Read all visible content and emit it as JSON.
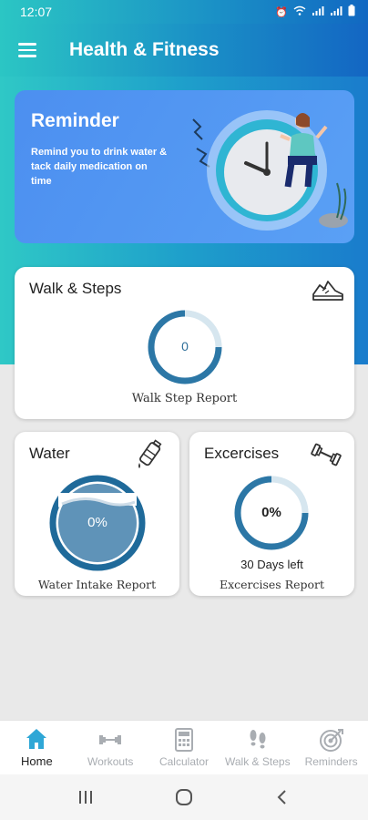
{
  "status_bar": {
    "time": "12:07"
  },
  "app_bar": {
    "title": "Health & Fitness"
  },
  "reminder": {
    "title": "Reminder",
    "text": "Remind you to drink water & tack daily medication on time"
  },
  "walk": {
    "title": "Walk & Steps",
    "steps": "0",
    "progress": 0,
    "footer": "Walk Step Report"
  },
  "water": {
    "title": "Water",
    "percent": "0%",
    "footer": "Water Intake Report"
  },
  "exercises": {
    "title": "Excercises",
    "percent": "0%",
    "days_left": "30 Days left",
    "footer": "Excercises Report"
  },
  "bottom_nav": [
    {
      "label": "Home",
      "icon": "home-icon",
      "active": true
    },
    {
      "label": "Workouts",
      "icon": "dumbbell-icon",
      "active": false
    },
    {
      "label": "Calculator",
      "icon": "calculator-icon",
      "active": false
    },
    {
      "label": "Walk & Steps",
      "icon": "footprints-icon",
      "active": false
    },
    {
      "label": "Reminders",
      "icon": "target-icon",
      "active": false
    }
  ],
  "colors": {
    "accent": "#2fa7d6",
    "active_nav": "#2fa7d6",
    "inactive_nav": "#a9adb2",
    "ring_dark": "#1f6a9a"
  }
}
